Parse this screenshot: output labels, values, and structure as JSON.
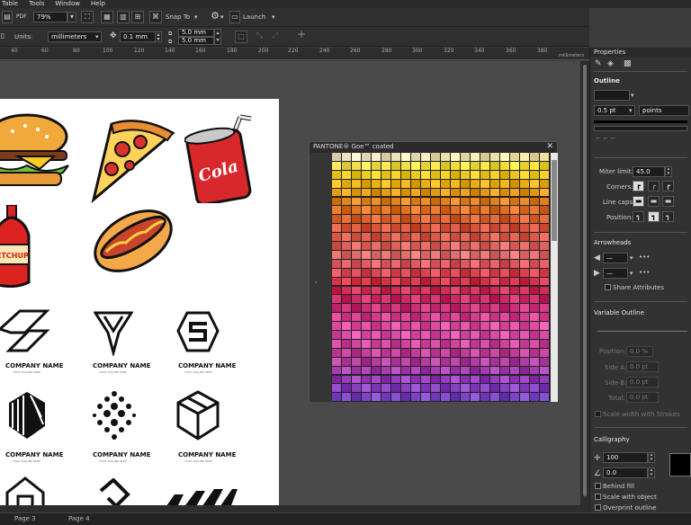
{
  "menu": [
    "Table",
    "Tools",
    "Window",
    "Help"
  ],
  "toolbar1": {
    "pdf_label": "PDF",
    "zoom": "79%",
    "snap_to": "Snap To",
    "launch": "Launch"
  },
  "toolbar2": {
    "units_label": "Units:",
    "units_value": "millimeters",
    "nudge": "0.1 mm",
    "dup_x": "5.0 mm",
    "dup_y": "5.0 mm"
  },
  "ruler": {
    "ticks": [
      "40",
      "60",
      "80",
      "100",
      "120",
      "140",
      "160",
      "180",
      "200",
      "220",
      "240",
      "260",
      "280",
      "300",
      "320",
      "340",
      "360",
      "380"
    ],
    "unit": "millimeters"
  },
  "canvas": {
    "logos": [
      {
        "name": "COMPANY NAME",
        "tagline": "YOUR TAGLINE HERE"
      },
      {
        "name": "COMPANY NAME",
        "tagline": "YOUR TAGLINE HERE"
      },
      {
        "name": "COMPANY NAME",
        "tagline": "YOUR TAGLINE HERE"
      },
      {
        "name": "COMPANY NAME",
        "tagline": "YOUR TAGLINE HERE"
      },
      {
        "name": "COMPANY NAME",
        "tagline": "YOUR TAGLINE HERE"
      },
      {
        "name": "COMPANY NAME",
        "tagline": "YOUR TAGLINE HERE"
      }
    ],
    "cola_text": "Cola",
    "ketchup_text": "ETCHUP"
  },
  "pantone": {
    "title": "PANTONE® Goe™ coated"
  },
  "properties": {
    "header": "Properties",
    "outline": "Outline",
    "width_value": "0.5 pt",
    "width_unit": "points",
    "miter_label": "Miter limit:",
    "miter_value": "45.0",
    "corners_label": "Corners:",
    "linecaps_label": "Line caps:",
    "position_label": "Position:",
    "arrowheads": "Arrowheads",
    "share_attributes": "Share Attributes",
    "variable_outline": "Variable Outline",
    "vo_position_label": "Position:",
    "vo_position_value": "0.0 %",
    "side_a_label": "Side A:",
    "side_a_value": "0.0 pt",
    "side_b_label": "Side B:",
    "side_b_value": "0.0 pt",
    "total_label": "Total:",
    "total_value": "0.0 pt",
    "scale_strokes": "Scale width with Strokes",
    "calligraphy": "Calligraphy",
    "stretch_value": "100",
    "angle_value": "0.0",
    "behind_fill": "Behind fill",
    "scale_with_object": "Scale with object",
    "overprint": "Overprint outline"
  },
  "status": {
    "page3": "Page 3",
    "page4": "Page 4"
  }
}
